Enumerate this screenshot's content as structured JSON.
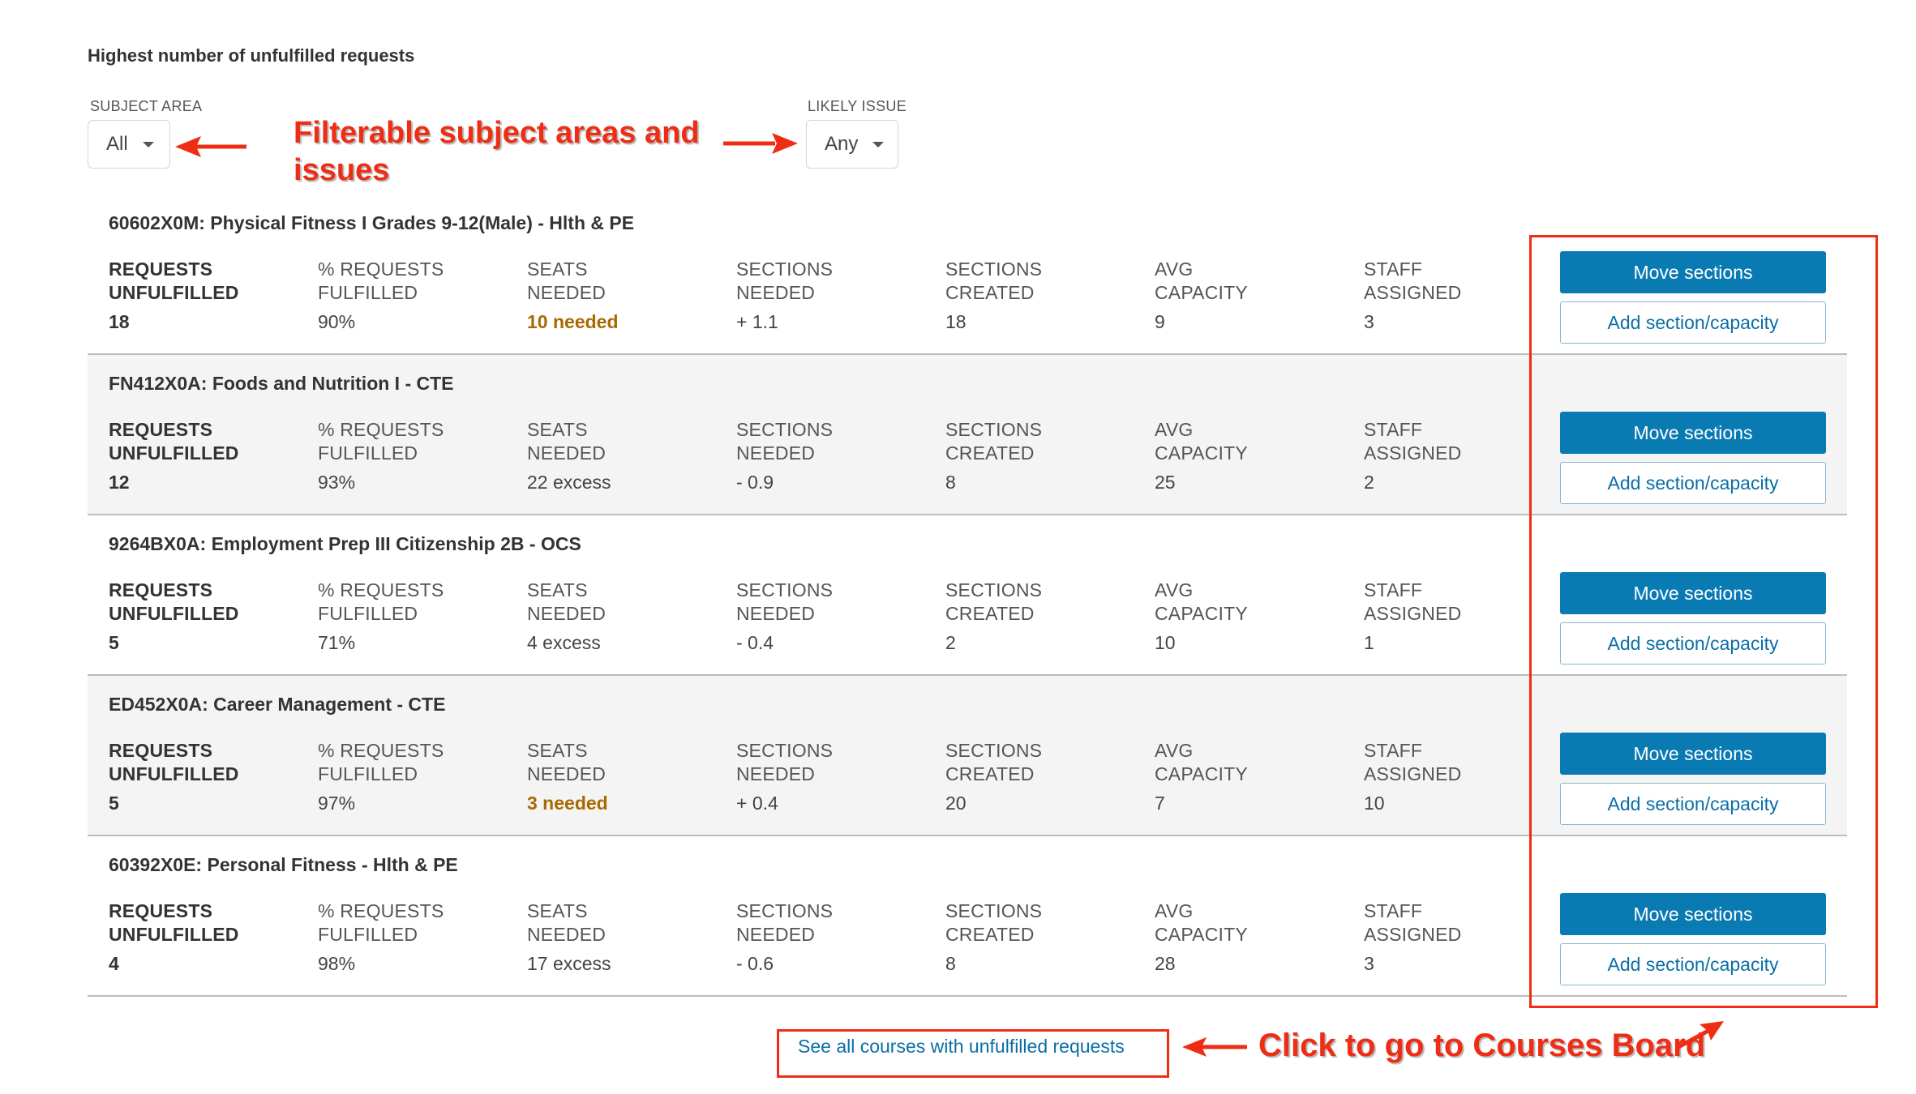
{
  "page": {
    "title": "Highest number of unfulfilled requests"
  },
  "filters": {
    "subject_area": {
      "label": "SUBJECT AREA",
      "value": "All"
    },
    "likely_issue": {
      "label": "LIKELY ISSUE",
      "value": "Any"
    }
  },
  "annotations": {
    "filters_note": "Filterable subject areas and issues",
    "courses_board_note": "Click to go to Courses Board"
  },
  "metric_labels": {
    "requests_unfulfilled": "REQUESTS\nUNFULFILLED",
    "pct_fulfilled": "% REQUESTS\nFULFILLED",
    "seats_needed": "SEATS\nNEEDED",
    "sections_needed": "SECTIONS\nNEEDED",
    "sections_created": "SECTIONS\nCREATED",
    "avg_capacity": "AVG\nCAPACITY",
    "staff_assigned": "STAFF\nASSIGNED"
  },
  "buttons": {
    "move_sections": "Move sections",
    "add_section": "Add section/capacity"
  },
  "courses": [
    {
      "title": "60602X0M: Physical Fitness I Grades 9-12(Male) - Hlth & PE",
      "requests_unfulfilled": "18",
      "pct_fulfilled": "90%",
      "seats_needed": "10 needed",
      "seats_warn": true,
      "sections_needed": "+ 1.1",
      "sections_created": "18",
      "avg_capacity": "9",
      "staff_assigned": "3"
    },
    {
      "title": "FN412X0A: Foods and Nutrition I - CTE",
      "requests_unfulfilled": "12",
      "pct_fulfilled": "93%",
      "seats_needed": "22 excess",
      "seats_warn": false,
      "sections_needed": "- 0.9",
      "sections_created": "8",
      "avg_capacity": "25",
      "staff_assigned": "2"
    },
    {
      "title": "9264BX0A: Employment Prep III Citizenship 2B - OCS",
      "requests_unfulfilled": "5",
      "pct_fulfilled": "71%",
      "seats_needed": "4 excess",
      "seats_warn": false,
      "sections_needed": "- 0.4",
      "sections_created": "2",
      "avg_capacity": "10",
      "staff_assigned": "1"
    },
    {
      "title": "ED452X0A: Career Management - CTE",
      "requests_unfulfilled": "5",
      "pct_fulfilled": "97%",
      "seats_needed": "3 needed",
      "seats_warn": true,
      "sections_needed": "+ 0.4",
      "sections_created": "20",
      "avg_capacity": "7",
      "staff_assigned": "10"
    },
    {
      "title": "60392X0E: Personal Fitness - Hlth & PE",
      "requests_unfulfilled": "4",
      "pct_fulfilled": "98%",
      "seats_needed": "17 excess",
      "seats_warn": false,
      "sections_needed": "- 0.6",
      "sections_created": "8",
      "avg_capacity": "28",
      "staff_assigned": "3"
    }
  ],
  "footer": {
    "see_all_link": "See all courses with unfulfilled requests"
  }
}
